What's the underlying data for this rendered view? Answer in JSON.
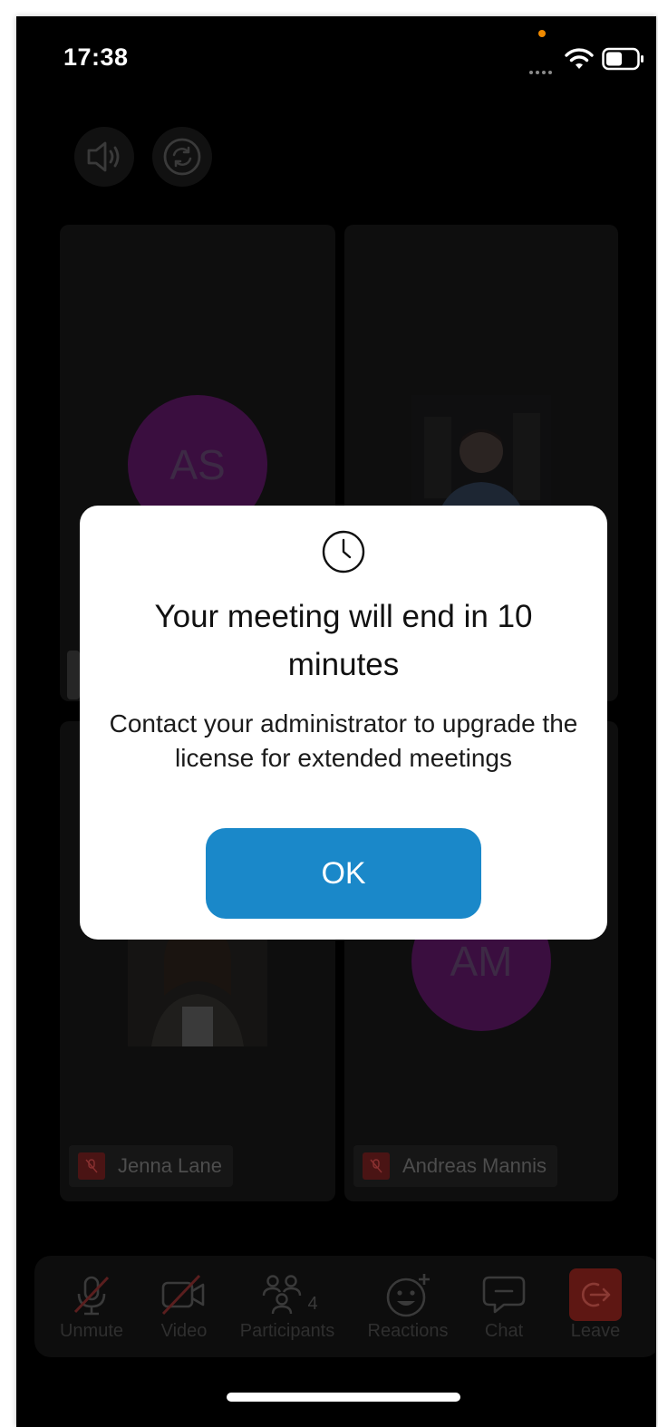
{
  "status_bar": {
    "time": "17:38"
  },
  "participants": [
    {
      "initials": "AS",
      "name": ""
    },
    {
      "initials": "",
      "name": ""
    },
    {
      "initials": "",
      "name": "Jenna Lane"
    },
    {
      "initials": "AM",
      "name": "Andreas Mannis"
    }
  ],
  "toolbar": {
    "unmute": "Unmute",
    "video": "Video",
    "participants": "Participants",
    "participant_count": "4",
    "reactions": "Reactions",
    "chat": "Chat",
    "leave": "Leave"
  },
  "modal": {
    "title": "Your meeting will end in 10 minutes",
    "body": "Contact your administrator to upgrade the license for extended meetings",
    "ok_label": "OK"
  },
  "colors": {
    "accent": "#1a88c9",
    "leave": "#b3261e",
    "avatar": "#3a0e3f"
  }
}
